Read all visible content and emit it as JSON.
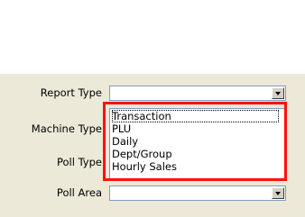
{
  "form": {
    "report_type": {
      "label": "Report Type",
      "value": ""
    },
    "machine_type": {
      "label": "Machine Type"
    },
    "poll_type": {
      "label": "Poll Type"
    },
    "poll_area": {
      "label": "Poll Area",
      "value": ""
    }
  },
  "dropdown": {
    "options": [
      "Transaction",
      "PLU",
      "Daily",
      "Dept/Group",
      "Hourly Sales"
    ]
  },
  "colors": {
    "panel_bg": "#ece9d8",
    "highlight": "#ff1010",
    "field_border": "#7f9db9"
  }
}
